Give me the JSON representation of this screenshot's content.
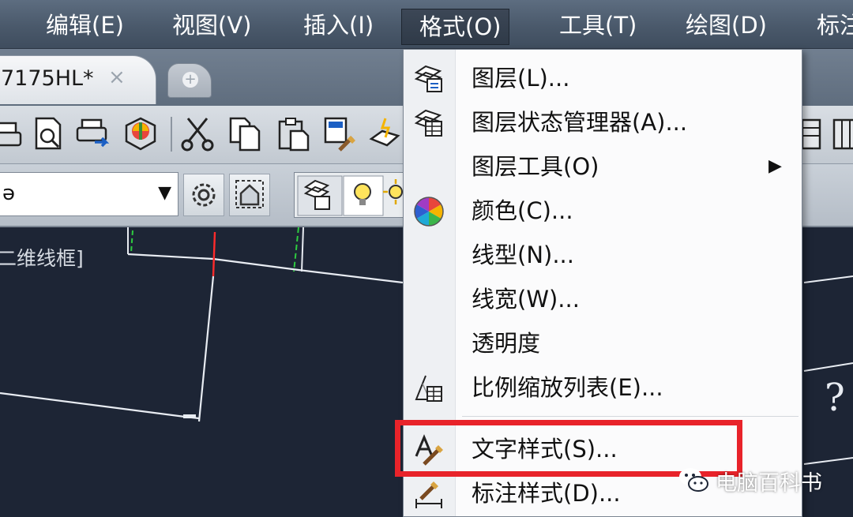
{
  "menubar": {
    "items": [
      {
        "label": "编辑(E)"
      },
      {
        "label": "视图(V)"
      },
      {
        "label": "插入(I)"
      },
      {
        "label": "格式(O)",
        "active": true
      },
      {
        "label": "工具(T)"
      },
      {
        "label": "绘图(D)"
      },
      {
        "label": "标注"
      }
    ]
  },
  "tabs": {
    "active_label": "7175HL*",
    "close_glyph": "×"
  },
  "toolbar2": {
    "combo_text": "ə"
  },
  "canvas": {
    "viewport_label": "二维线框]",
    "help_glyph": "?"
  },
  "format_menu": {
    "items": [
      {
        "label": "图层(L)...",
        "icon": "layer-icon"
      },
      {
        "label": "图层状态管理器(A)...",
        "icon": "layer-state-icon"
      },
      {
        "label": "图层工具(O)",
        "icon": "none",
        "submenu": true
      },
      {
        "label": "颜色(C)...",
        "icon": "color-wheel-icon"
      },
      {
        "label": "线型(N)...",
        "icon": "none"
      },
      {
        "label": "线宽(W)...",
        "icon": "none"
      },
      {
        "label": "透明度",
        "icon": "none"
      },
      {
        "label": "比例缩放列表(E)...",
        "icon": "scale-list-icon"
      },
      {
        "label": "文字样式(S)...",
        "icon": "text-style-icon",
        "highlighted": true
      },
      {
        "label": "标注样式(D)...",
        "icon": "dimension-style-icon"
      }
    ],
    "submenu_arrow": "▶"
  },
  "watermark": {
    "text": "电脑百科书"
  },
  "colors": {
    "highlight_border": "#e8232a",
    "canvas_bg": "#1d2535",
    "menubar_bg": "#4a596b"
  }
}
